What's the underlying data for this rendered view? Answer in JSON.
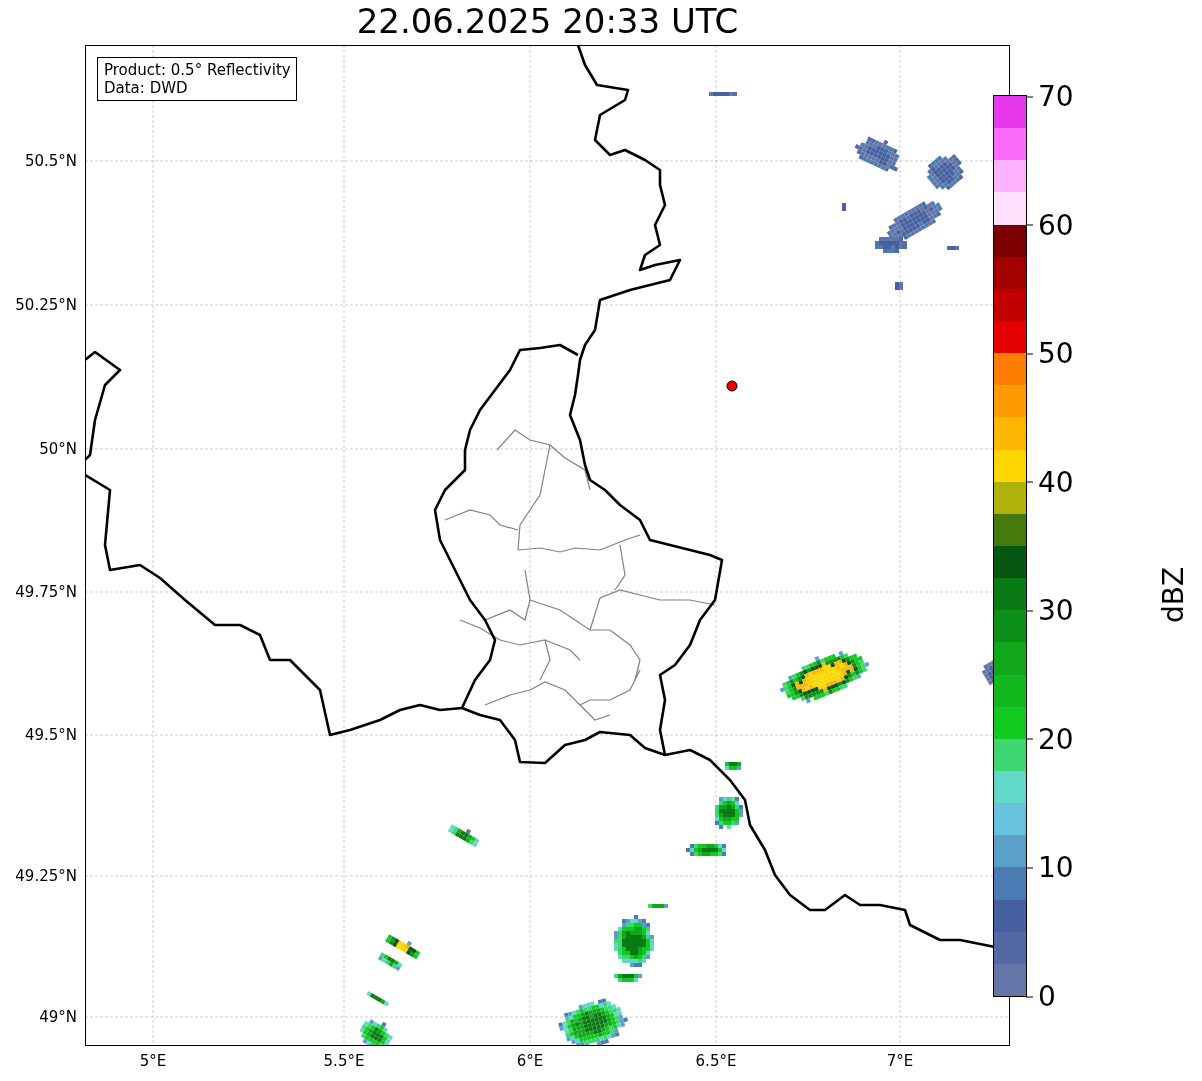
{
  "title": "22.06.2025 20:33 UTC",
  "map": {
    "info_box": [
      "Product: 0.5° Reflectivity",
      "Data: DWD"
    ],
    "x_ticks": [
      "5°E",
      "5.5°E",
      "6°E",
      "6.5°E",
      "7°E"
    ],
    "y_ticks": [
      "50.5°N",
      "50.25°N",
      "50°N",
      "49.75°N",
      "49.5°N",
      "49.25°N",
      "49°N"
    ]
  },
  "colorbar": {
    "label": "dBZ",
    "ticks": [
      "70",
      "60",
      "50",
      "40",
      "30",
      "20",
      "10",
      "0"
    ],
    "bins": [
      {
        "color": "#e738ee"
      },
      {
        "color": "#fd6bfd"
      },
      {
        "color": "#fdb2fd"
      },
      {
        "color": "#fde1fd"
      },
      {
        "color": "#7c0000"
      },
      {
        "color": "#a40000"
      },
      {
        "color": "#c20000"
      },
      {
        "color": "#e40000"
      },
      {
        "color": "#fd7d00"
      },
      {
        "color": "#fd9b00"
      },
      {
        "color": "#fdb700"
      },
      {
        "color": "#fdd600"
      },
      {
        "color": "#b0b20a"
      },
      {
        "color": "#467a0c"
      },
      {
        "color": "#05560f"
      },
      {
        "color": "#0a7b14"
      },
      {
        "color": "#0c901a"
      },
      {
        "color": "#10a81a"
      },
      {
        "color": "#13b81f"
      },
      {
        "color": "#12c91f"
      },
      {
        "color": "#3ed670"
      },
      {
        "color": "#63d8c8"
      },
      {
        "color": "#67c3dc"
      },
      {
        "color": "#5ba0c8"
      },
      {
        "color": "#4a7cb3"
      },
      {
        "color": "#4460a0"
      },
      {
        "color": "#5468a3"
      },
      {
        "color": "#6575a8"
      }
    ]
  }
}
